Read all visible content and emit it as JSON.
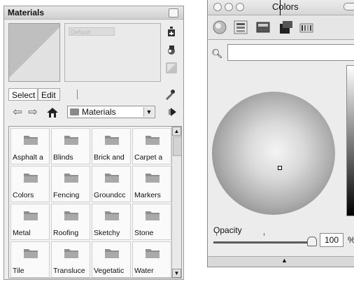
{
  "materials": {
    "title": "Materials",
    "name_placeholder": "Default",
    "tabs": [
      {
        "label": "Select",
        "active": true
      },
      {
        "label": "Edit",
        "active": false
      }
    ],
    "library_dropdown": "Materials",
    "folders": [
      "Asphalt a",
      "Blinds",
      "Brick and",
      "Carpet a",
      "Colors",
      "Fencing",
      "Groundcc",
      "Markers",
      "Metal",
      "Roofing",
      "Sketchy",
      "Stone",
      "Tile",
      "Transluce",
      "Vegetatic",
      "Water"
    ],
    "icons": [
      "create-material-icon",
      "sample-paint-icon",
      "default-material-icon",
      "eyedropper-icon",
      "back-arrow-icon",
      "forward-arrow-icon",
      "home-icon",
      "details-arrow-icon",
      "folder-icon"
    ]
  },
  "colors": {
    "title": "Colors",
    "toolbar": [
      "color-wheel-icon",
      "color-sliders-icon",
      "color-palettes-icon",
      "image-palettes-icon",
      "crayons-icon"
    ],
    "search_value": "",
    "opacity_label": "Opacity",
    "opacity_value": "100",
    "opacity_unit": "%",
    "opacity_level": 1.0,
    "accent": "#8a8a8a"
  }
}
